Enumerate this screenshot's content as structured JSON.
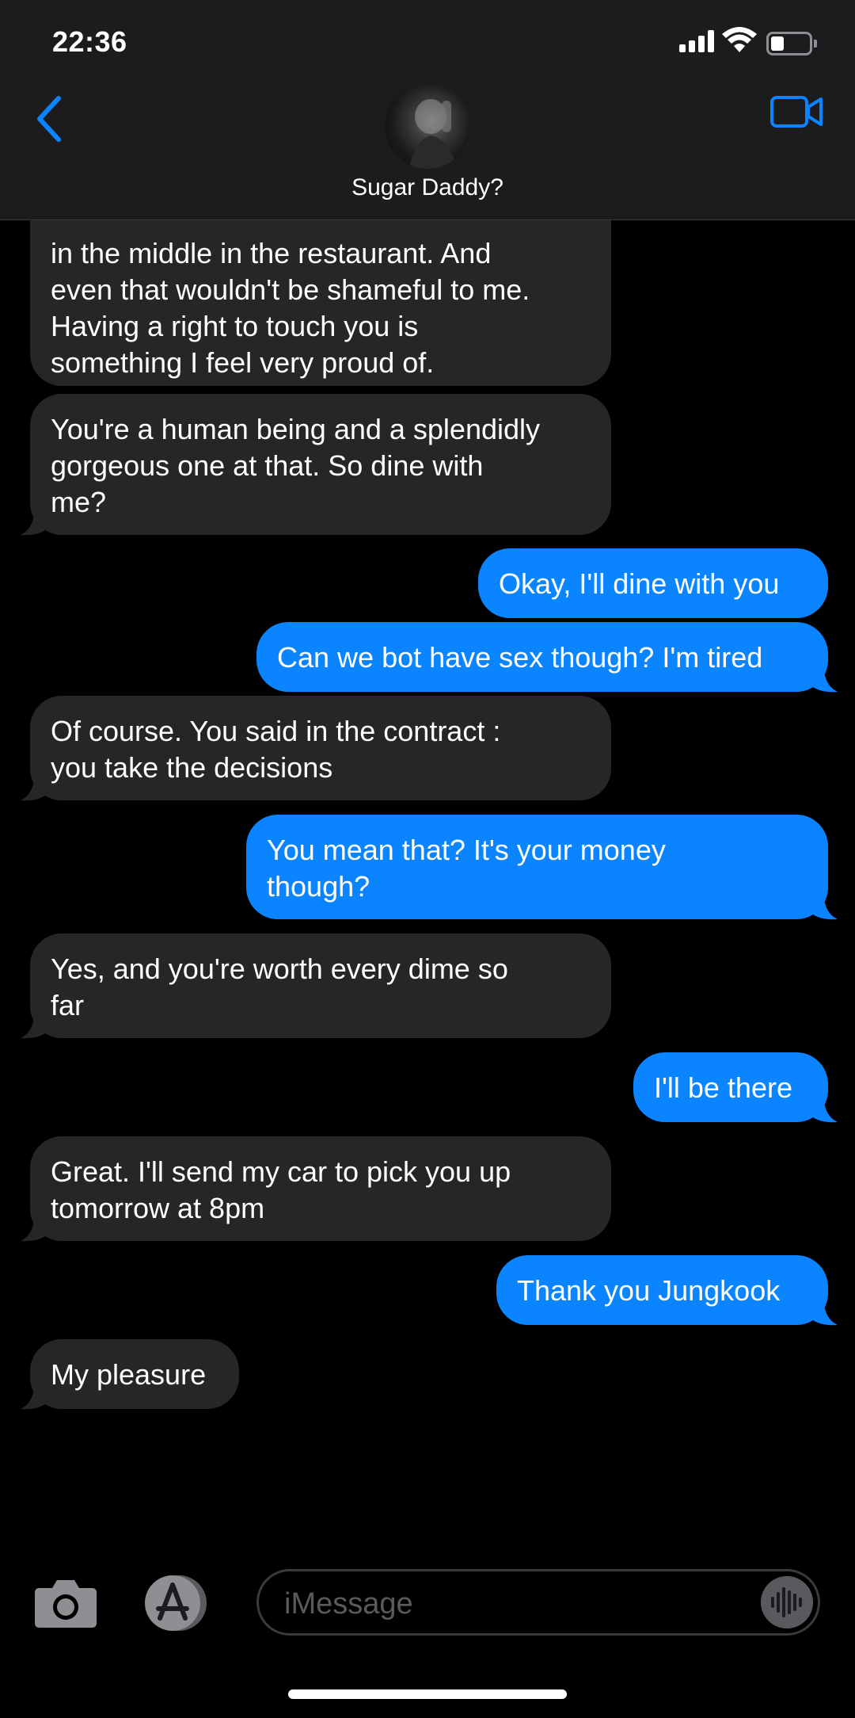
{
  "status": {
    "time": "22:36"
  },
  "header": {
    "contact_name": "Sugar Daddy?"
  },
  "messages": [
    {
      "dir": "in",
      "lines": [
        "in the middle in the restaurant. And",
        "even that wouldn't be shameful to me.",
        "Having a right to touch you is",
        "something I feel very proud of."
      ]
    },
    {
      "dir": "in",
      "lines": [
        "You're a human being and a splendidly",
        "gorgeous one at that. So dine with",
        "me?"
      ]
    },
    {
      "dir": "out",
      "lines": [
        "Okay, I'll dine with you"
      ]
    },
    {
      "dir": "out",
      "lines": [
        "Can we bot have sex though? I'm tired"
      ]
    },
    {
      "dir": "in",
      "lines": [
        "Of course. You said in the contract :",
        "you take the decisions"
      ]
    },
    {
      "dir": "out",
      "lines": [
        "You mean that? It's your money",
        "though?"
      ]
    },
    {
      "dir": "in",
      "lines": [
        "Yes, and you're worth every dime so",
        "far"
      ]
    },
    {
      "dir": "out",
      "lines": [
        "I'll be there"
      ]
    },
    {
      "dir": "in",
      "lines": [
        "Great. I'll send my car to pick you up",
        "tomorrow at 8pm"
      ]
    },
    {
      "dir": "out",
      "lines": [
        "Thank you Jungkook"
      ]
    },
    {
      "dir": "in",
      "lines": [
        "My pleasure"
      ]
    }
  ],
  "composer": {
    "placeholder": "iMessage"
  },
  "icons": {
    "back": "chevron-left-icon",
    "video": "video-camera-icon",
    "camera": "camera-icon",
    "apps": "app-store-icon",
    "audio": "waveform-icon"
  },
  "colors": {
    "outgoing": "#0b84ff",
    "incoming": "#262628",
    "accent": "#0b84ff"
  }
}
